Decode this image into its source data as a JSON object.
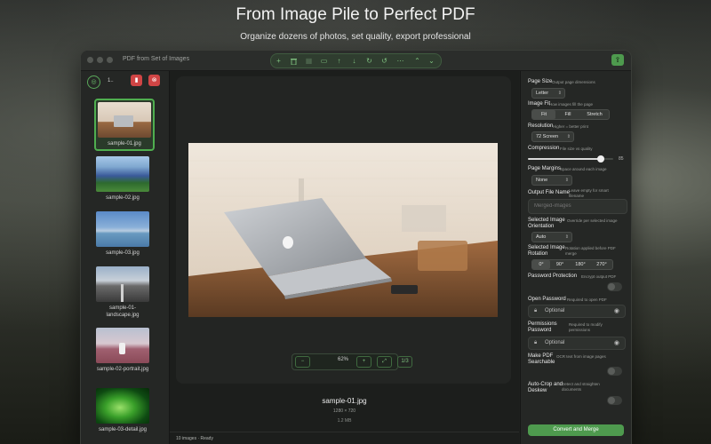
{
  "hero": {
    "title": "From Image Pile to Perfect PDF",
    "subtitle": "Organize dozens of photos, set quality, export professional"
  },
  "window": {
    "title": "PDF from Set of Images",
    "toolbar_icons": [
      "add-icon",
      "trash-icon",
      "grid-icon",
      "sidebar-icon",
      "move-up-icon",
      "move-down-icon",
      "rotate-right-icon",
      "rotate-left-icon",
      "more-icon",
      "chevron-up-icon",
      "chevron-down-icon"
    ],
    "share_icon": "share-icon"
  },
  "sidebar": {
    "count": "1..",
    "items": [
      {
        "label": "sample-01.jpg",
        "selected": true
      },
      {
        "label": "sample-02.jpg"
      },
      {
        "label": "sample-03.jpg"
      },
      {
        "label": "sample-01-landscape.jpg"
      },
      {
        "label": "sample-02-portrait.jpg"
      },
      {
        "label": "sample-03-detail.jpg"
      }
    ]
  },
  "preview": {
    "zoom": "62%",
    "page_indicator": "1/3",
    "filename": "sample-01.jpg",
    "dimensions": "1280 × 720",
    "filesize": "1.2 MB",
    "status": "10 images · Ready"
  },
  "settings": {
    "page_size": {
      "label": "Page Size",
      "hint": "Output page dimensions",
      "value": "Letter"
    },
    "image_fit": {
      "label": "Image Fit",
      "hint": "How images fill the page",
      "options": [
        "Fit",
        "Fill",
        "Stretch"
      ],
      "selected": "Fit"
    },
    "resolution": {
      "label": "Resolution",
      "hint": "Higher = better print",
      "value": "72 Screen"
    },
    "compression": {
      "label": "Compression",
      "hint": "File size vs quality",
      "value": 85,
      "value_text": "85"
    },
    "page_margins": {
      "label": "Page Margins",
      "hint": "Space around each image",
      "value": "None"
    },
    "output_name": {
      "label": "Output File Name",
      "hint": "Leave empty for smart filename",
      "placeholder": "Merged-images"
    },
    "orientation": {
      "label": "Selected Image Orientation",
      "hint": "Override per selected image",
      "value": "Auto"
    },
    "rotation": {
      "label": "Selected Image Rotation",
      "hint": "Rotation applied before PDF merge",
      "options": [
        "0°",
        "90°",
        "180°",
        "270°"
      ],
      "selected": "0°"
    },
    "password_protection": {
      "label": "Password Protection",
      "hint": "Encrypt output PDF",
      "enabled": false
    },
    "open_password": {
      "label": "Open Password",
      "hint": "Required to open PDF",
      "placeholder": "Optional"
    },
    "permissions_password": {
      "label": "Permissions Password",
      "hint": "Required to modify permissions",
      "placeholder": "Optional"
    },
    "searchable": {
      "label": "Make PDF Searchable",
      "hint": "OCR text from image pages",
      "enabled": false
    },
    "autocrop": {
      "label": "Auto-Crop and Deskew",
      "hint": "Detect and straighten documents",
      "enabled": false
    },
    "convert_label": "Convert and Merge"
  },
  "colors": {
    "accent": "#4e9a4e",
    "danger": "#d04545"
  }
}
